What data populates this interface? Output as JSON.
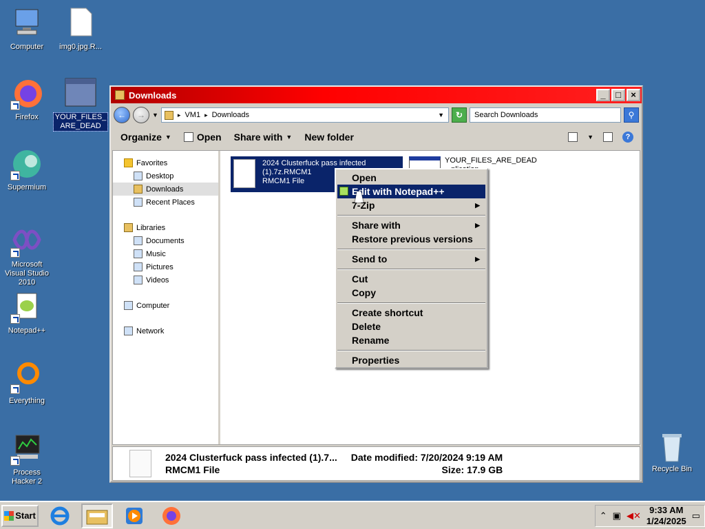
{
  "desktop": {
    "icons": [
      {
        "label": "Computer",
        "icon": "computer-icon"
      },
      {
        "label": "img0.jpg.R...",
        "icon": "file-icon"
      },
      {
        "label": "Firefox",
        "icon": "firefox-icon"
      },
      {
        "label": "YOUR_FILES_ARE_DEAD",
        "icon": "app-window-icon"
      },
      {
        "label": "Supermium",
        "icon": "supermium-icon"
      },
      {
        "label": "Microsoft Visual Studio 2010",
        "icon": "visual-studio-icon"
      },
      {
        "label": "Notepad++",
        "icon": "notepadpp-icon"
      },
      {
        "label": "Everything",
        "icon": "everything-icon"
      },
      {
        "label": "Process Hacker 2",
        "icon": "process-hacker-icon"
      }
    ],
    "recycle_bin": "Recycle Bin"
  },
  "window": {
    "title": "Downloads",
    "breadcrumb": [
      "VM1",
      "Downloads"
    ],
    "search_placeholder": "Search Downloads",
    "toolbar": {
      "organize": "Organize",
      "open": "Open",
      "share_with": "Share with",
      "new_folder": "New folder"
    },
    "nav": {
      "favorites": "Favorites",
      "desktop": "Desktop",
      "downloads": "Downloads",
      "recent": "Recent Places",
      "libraries": "Libraries",
      "documents": "Documents",
      "music": "Music",
      "pictures": "Pictures",
      "videos": "Videos",
      "computer": "Computer",
      "network": "Network"
    },
    "files": [
      {
        "name_line1": "2024 Clusterfuck pass infected",
        "name_line2": "(1).7z.RMCM1",
        "type": "RMCM1 File"
      },
      {
        "name_line1": "YOUR_FILES_ARE_DEAD",
        "name_line2": "...plication"
      }
    ],
    "details": {
      "name": "2024 Clusterfuck pass infected (1).7...",
      "type": "RMCM1 File",
      "date_label": "Date modified: 7/20/2024 9:19 AM",
      "size_label": "Size: 17.9 GB"
    }
  },
  "context_menu": {
    "open": "Open",
    "edit_npp": "Edit with Notepad++",
    "zip": "7-Zip",
    "share_with": "Share with",
    "restore": "Restore previous versions",
    "send_to": "Send to",
    "cut": "Cut",
    "copy": "Copy",
    "create_shortcut": "Create shortcut",
    "delete": "Delete",
    "rename": "Rename",
    "properties": "Properties"
  },
  "taskbar": {
    "start": "Start",
    "time": "9:33 AM",
    "date": "1/24/2025"
  },
  "colors": {
    "desktop": "#3a6ea5",
    "titlebar": "#ff0000",
    "selection": "#0a246a"
  }
}
